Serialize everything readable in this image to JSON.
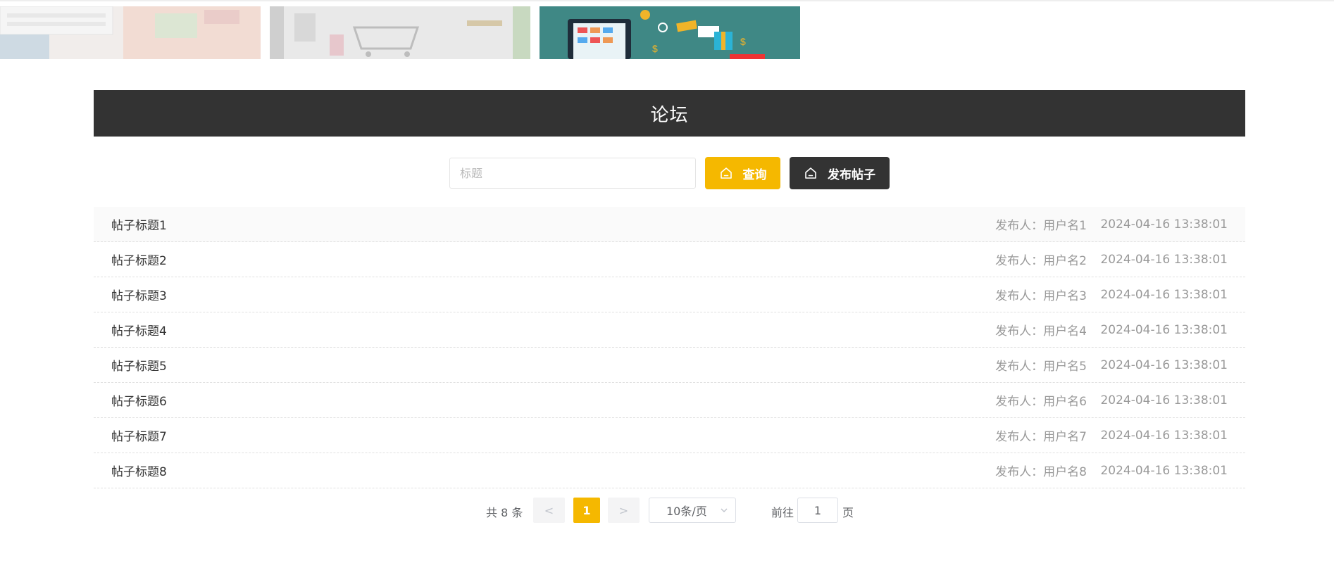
{
  "forum": {
    "title": "论坛"
  },
  "search": {
    "placeholder": "标题",
    "value": "",
    "query_label": "查询",
    "publish_label": "发布帖子"
  },
  "posts": [
    {
      "title": "帖子标题1",
      "author": "发布人：用户名1",
      "time": "2024-04-16 13:38:01"
    },
    {
      "title": "帖子标题2",
      "author": "发布人：用户名2",
      "time": "2024-04-16 13:38:01"
    },
    {
      "title": "帖子标题3",
      "author": "发布人：用户名3",
      "time": "2024-04-16 13:38:01"
    },
    {
      "title": "帖子标题4",
      "author": "发布人：用户名4",
      "time": "2024-04-16 13:38:01"
    },
    {
      "title": "帖子标题5",
      "author": "发布人：用户名5",
      "time": "2024-04-16 13:38:01"
    },
    {
      "title": "帖子标题6",
      "author": "发布人：用户名6",
      "time": "2024-04-16 13:38:01"
    },
    {
      "title": "帖子标题7",
      "author": "发布人：用户名7",
      "time": "2024-04-16 13:38:01"
    },
    {
      "title": "帖子标题8",
      "author": "发布人：用户名8",
      "time": "2024-04-16 13:38:01"
    }
  ],
  "pagination": {
    "total_text": "共 8 条",
    "prev_symbol": "<",
    "current_page": "1",
    "next_symbol": ">",
    "page_size": "10条/页",
    "goto_label": "前往",
    "goto_value": "1",
    "page_suffix": "页"
  },
  "colors": {
    "accent": "#f5b800",
    "header_bg": "#333333"
  },
  "icons": {
    "query": "home-icon",
    "publish": "home-icon",
    "select": "chevron-down-icon"
  }
}
